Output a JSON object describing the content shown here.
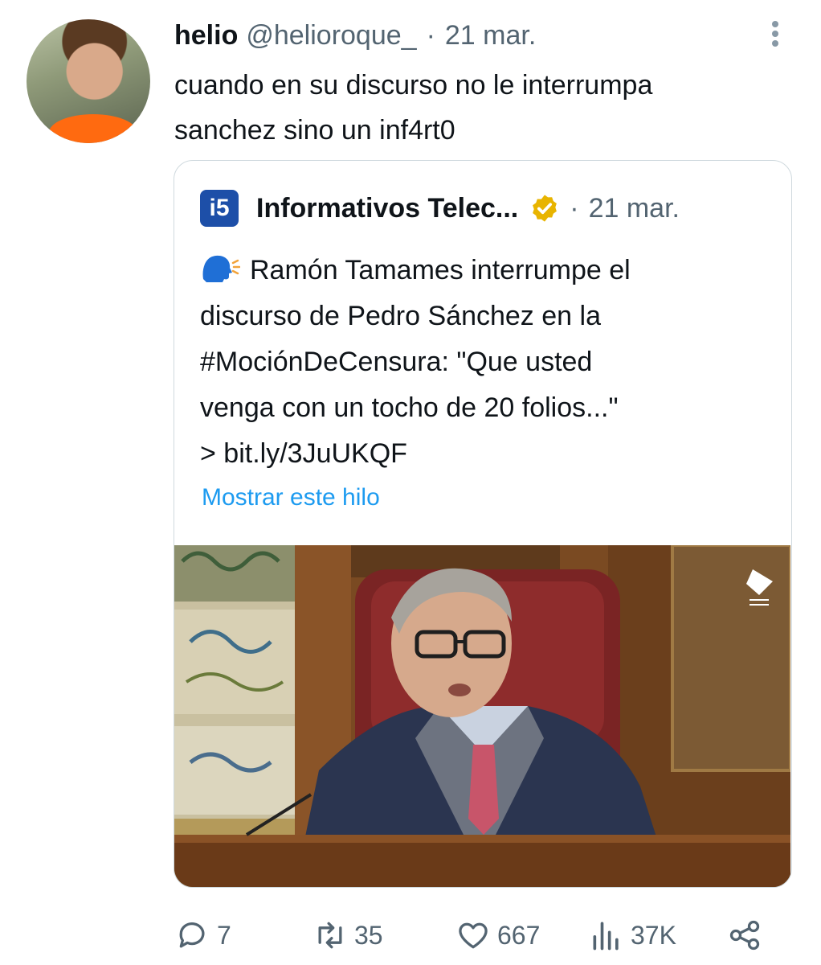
{
  "tweet": {
    "author_name": "helio",
    "author_handle": "@helioroque_",
    "separator": "·",
    "date": "21 mar.",
    "text": "cuando en su discurso no le interrumpa\nsanchez sino un inf4rt0"
  },
  "quoted": {
    "logo_text": "i5",
    "author_name": "Informativos Telec...",
    "separator": "·",
    "date": "21 mar.",
    "speaking_icon": "speaking-head-emoji",
    "text": "Ramón Tamames interrumpe el\ndiscurso de Pedro Sánchez en la\n#MociónDeCensura: \"Que usted\nvenga con un tocho de 20 folios...\"\n> bit.ly/3JuUKQF",
    "show_thread": "Mostrar este hilo"
  },
  "actions": {
    "replies": "7",
    "retweets": "35",
    "likes": "667",
    "views": "37K"
  },
  "colors": {
    "text": "#0f1419",
    "muted": "#536471",
    "link": "#1d9bf0",
    "border": "#cfd9de",
    "verified": "#e8b400"
  }
}
